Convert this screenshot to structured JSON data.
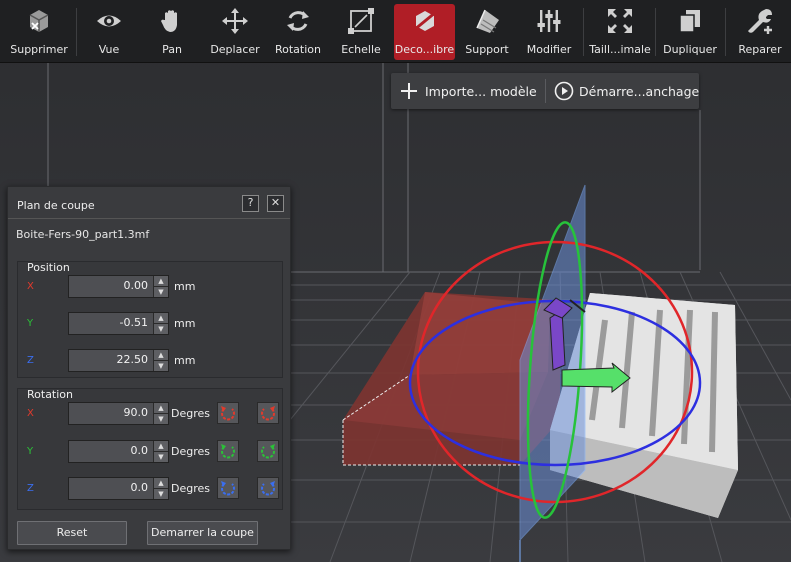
{
  "toolbar": {
    "items": [
      {
        "label": "Supprimer",
        "icon": "cube-delete-icon"
      },
      {
        "label": "Vue",
        "icon": "eye-icon"
      },
      {
        "label": "Pan",
        "icon": "hand-icon"
      },
      {
        "label": "Deplacer",
        "icon": "move-arrows-icon"
      },
      {
        "label": "Rotation",
        "icon": "rotate-icon"
      },
      {
        "label": "Echelle",
        "icon": "scale-icon"
      },
      {
        "label": "Deco...ibre",
        "icon": "cut-plane-icon"
      },
      {
        "label": "Support",
        "icon": "support-icon"
      },
      {
        "label": "Modifier",
        "icon": "sliders-icon"
      },
      {
        "label": "Taill...imale",
        "icon": "maximize-icon"
      },
      {
        "label": "Dupliquer",
        "icon": "duplicate-icon"
      },
      {
        "label": "Reparer",
        "icon": "wrench-icon"
      }
    ],
    "active_index": 6,
    "active_color": "#b01e26"
  },
  "top_actions": {
    "import_label": "Importe... modèle",
    "start_label": "Démarre...anchage"
  },
  "panel": {
    "title": "Plan de coupe",
    "help_label": "?",
    "close_label": "✕",
    "filename": "Boite-Fers-90_part1.3mf",
    "position": {
      "title": "Position",
      "x_label": "X",
      "x_value": "0.00",
      "y_label": "Y",
      "y_value": "-0.51",
      "z_label": "Z",
      "z_value": "22.50",
      "unit": "mm"
    },
    "rotation": {
      "title": "Rotation",
      "x_label": "X",
      "x_value": "90.0",
      "y_label": "Y",
      "y_value": "0.0",
      "z_label": "Z",
      "z_value": "0.0",
      "unit": "Degres"
    },
    "reset_label": "Reset",
    "start_cut_label": "Demarrer la coupe"
  },
  "colors": {
    "axis_x": "#e23a2c",
    "axis_y": "#2bc238",
    "axis_z": "#3a6ef0"
  }
}
